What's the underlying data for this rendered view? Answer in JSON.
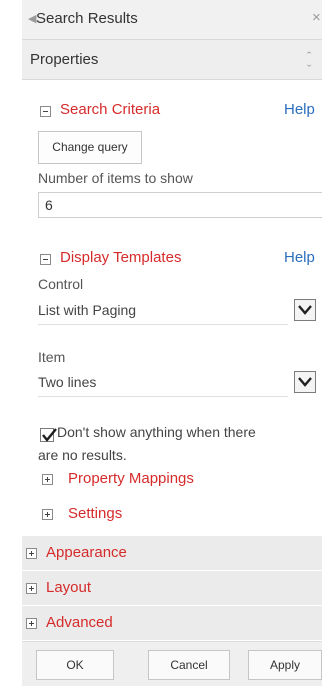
{
  "window": {
    "title": "Search Results"
  },
  "properties": {
    "label": "Properties"
  },
  "search_criteria": {
    "heading": "Search Criteria",
    "help": "Help",
    "change_query": "Change query",
    "items_label": "Number of items to show",
    "items_value": "6"
  },
  "display_templates": {
    "heading": "Display Templates",
    "help": "Help",
    "control_label": "Control",
    "control_value": "List with Paging",
    "item_label": "Item",
    "item_value": "Two lines",
    "checkbox_line1": "Don't show anything when there",
    "checkbox_line2": "are no results.",
    "checkbox_checked": true,
    "property_mappings": "Property Mappings",
    "settings": "Settings"
  },
  "sections": {
    "appearance": "Appearance",
    "layout": "Layout",
    "advanced": "Advanced"
  },
  "footer": {
    "ok": "OK",
    "cancel": "Cancel",
    "apply": "Apply"
  }
}
